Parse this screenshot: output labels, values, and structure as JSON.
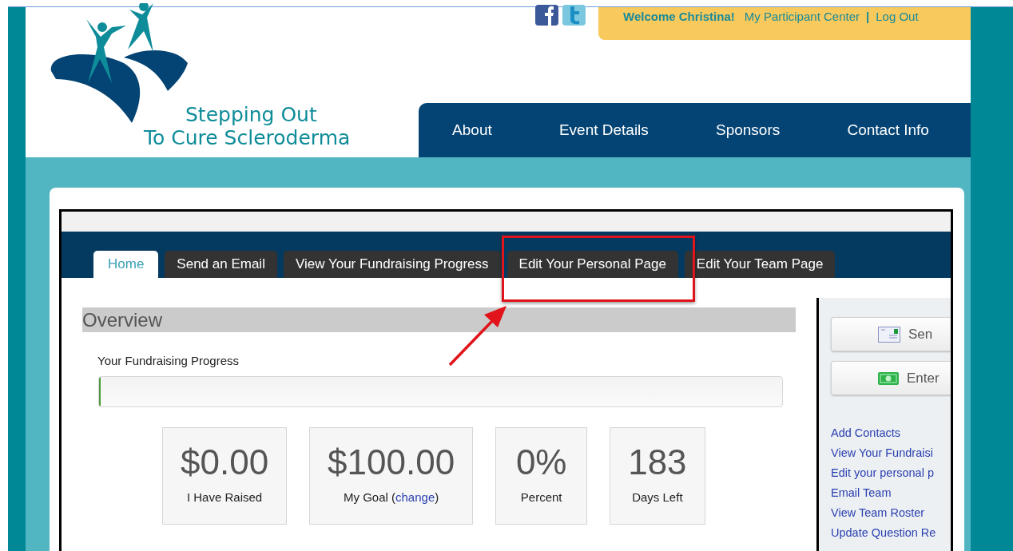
{
  "header": {
    "logo": {
      "line_1": "Stepping Out",
      "line_2": "To Cure Scleroderma"
    },
    "user_bar": {
      "welcome": "Welcome Christina!",
      "links": [
        "My Participant Center",
        "Log Out"
      ],
      "separator": "|"
    },
    "nav": [
      {
        "label": "About"
      },
      {
        "label": "Event Details"
      },
      {
        "label": "Sponsors"
      },
      {
        "label": "Contact Info"
      }
    ]
  },
  "tabs": [
    {
      "label": "Home",
      "selected": true
    },
    {
      "label": "Send an Email",
      "selected": false
    },
    {
      "label": "View Your Fundraising Progress",
      "selected": false
    },
    {
      "label": "Edit Your Personal Page",
      "selected": false
    },
    {
      "label": "Edit Your Team Page",
      "selected": false
    }
  ],
  "overview": {
    "title": "Overview",
    "progress_label": "Your Fundraising Progress",
    "level": 0,
    "stats": [
      {
        "value": "$0.00",
        "label": "I Have Raised"
      },
      {
        "value": "$100.00",
        "label": "My Goal (",
        "link": "change",
        "label_end": ")"
      },
      {
        "value": "0%",
        "label": "Percent"
      },
      {
        "value": "183",
        "label": "Days Left"
      }
    ]
  },
  "sidebar": {
    "buttons": [
      {
        "kind": "email",
        "label": "Sen"
      },
      {
        "kind": "money",
        "label": "Enter"
      }
    ],
    "links": [
      "Add Contacts",
      "View Your Fundraisi",
      "Edit your personal p",
      "Email Team",
      "View Team Roster",
      "Update Question Re"
    ]
  }
}
